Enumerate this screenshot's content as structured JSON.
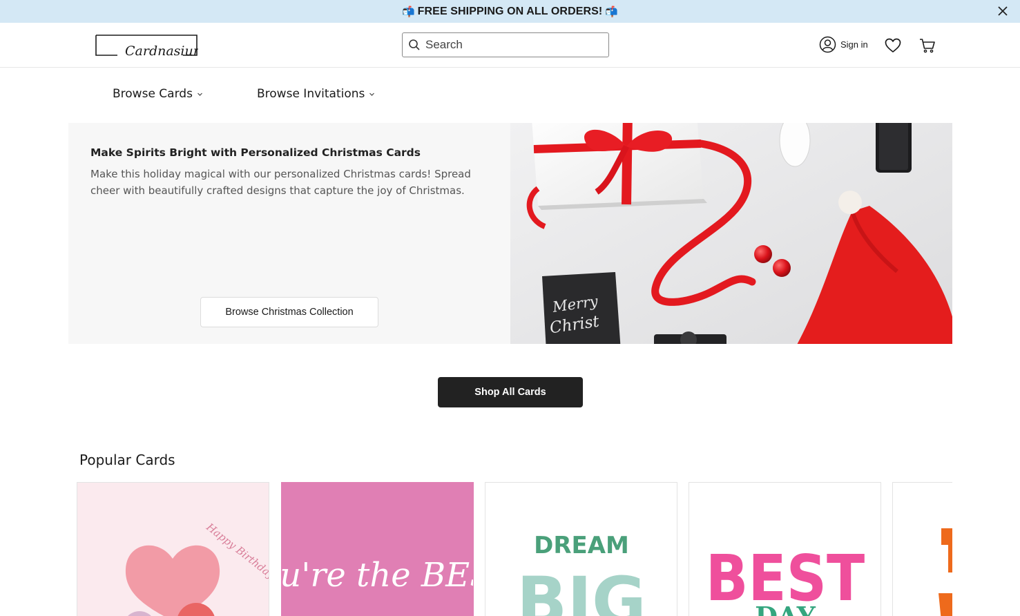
{
  "promo": {
    "text": "FREE SHIPPING ON ALL ORDERS!",
    "icon_left": "mailbox-icon",
    "icon_right": "mailbox-icon",
    "background": "#d4e8f5"
  },
  "header": {
    "logo_text": "Cardnasium",
    "search_placeholder": "Search",
    "sign_in_label": "Sign in",
    "icons": [
      "user-icon",
      "heart-icon",
      "cart-icon"
    ]
  },
  "nav": {
    "items": [
      {
        "label": "Browse Cards"
      },
      {
        "label": "Browse Invitations"
      }
    ]
  },
  "hero": {
    "title": "Make Spirits Bright with Personalized Christmas Cards",
    "description": "Make this holiday magical with our personalized Christmas cards! Spread cheer with beautifully crafted designs that capture the joy of Christmas.",
    "button_label": "Browse Christmas Collection",
    "image_card_text": "Merry Christmas",
    "accent": "#e3191f"
  },
  "shop_all_label": "Shop All Cards",
  "popular": {
    "title": "Popular Cards",
    "cards": [
      {
        "text": "Happy Birthday",
        "bg": "#fbeaee"
      },
      {
        "text": "You're the BEST",
        "bg": "#e07fb4"
      },
      {
        "text_top": "DREAM",
        "text_bottom": "BIG",
        "bg": "#ffffff"
      },
      {
        "text_top": "BEST",
        "text_bottom": "DAY",
        "bg": "#ffffff"
      },
      {
        "bg": "#ffffff"
      }
    ]
  }
}
